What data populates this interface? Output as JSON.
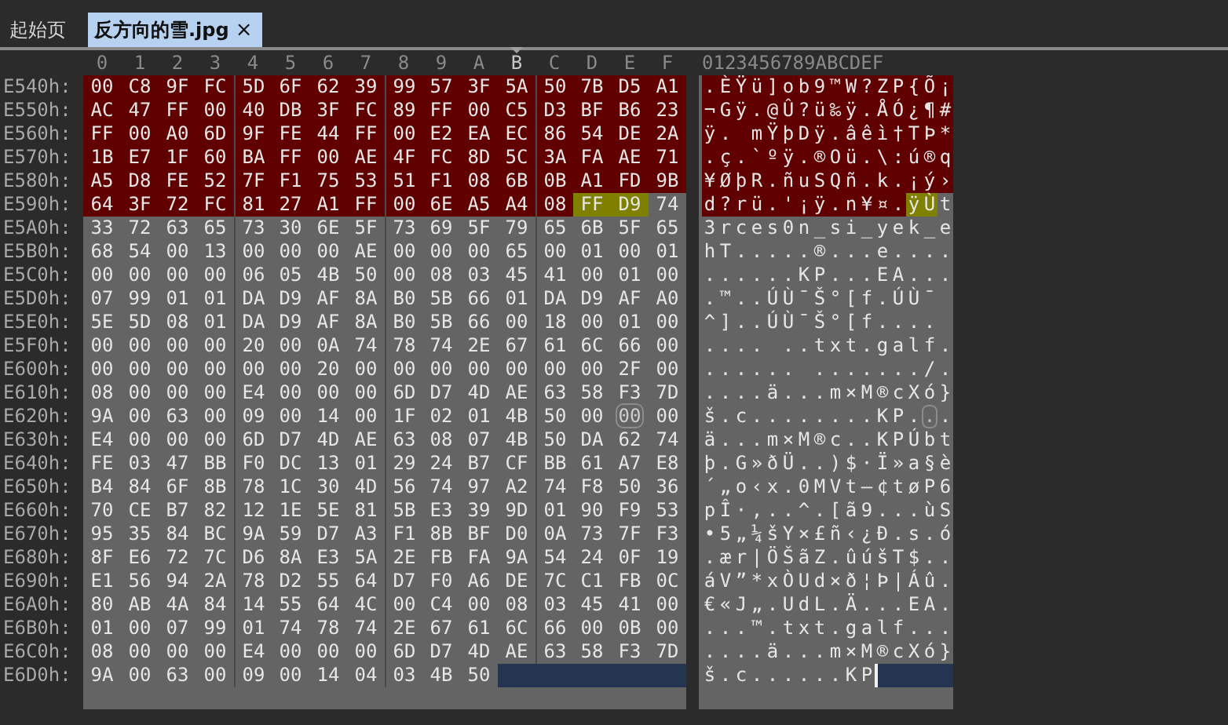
{
  "tabs": [
    {
      "label": "起始页",
      "selected": false
    },
    {
      "label": "反方向的雪.jpg",
      "selected": true,
      "close": "×"
    }
  ],
  "columns": [
    {
      "label": "0",
      "current": false
    },
    {
      "label": "1",
      "current": false
    },
    {
      "label": "2",
      "current": false
    },
    {
      "label": "3",
      "current": false
    },
    {
      "label": "4",
      "current": false
    },
    {
      "label": "5",
      "current": false
    },
    {
      "label": "6",
      "current": false
    },
    {
      "label": "7",
      "current": false
    },
    {
      "label": "8",
      "current": false
    },
    {
      "label": "9",
      "current": false
    },
    {
      "label": "A",
      "current": false
    },
    {
      "label": "B",
      "current": true
    },
    {
      "label": "C",
      "current": false
    },
    {
      "label": "D",
      "current": false
    },
    {
      "label": "E",
      "current": false
    },
    {
      "label": "F",
      "current": false
    }
  ],
  "ascii_header": "0123456789ABCDEF",
  "rows": [
    {
      "offset": "E540h:",
      "segments": [
        {
          "kind": "selected",
          "bytes": [
            "00",
            "C8",
            "9F",
            "FC",
            "5D",
            "6F",
            "62",
            "39",
            "99",
            "57",
            "3F",
            "5A",
            "50",
            "7B",
            "D5",
            "A1"
          ],
          "ascii": ".ÈŸü]ob9™W?ZP{Õ¡"
        }
      ]
    },
    {
      "offset": "E550h:",
      "segments": [
        {
          "kind": "selected",
          "bytes": [
            "AC",
            "47",
            "FF",
            "00",
            "40",
            "DB",
            "3F",
            "FC",
            "89",
            "FF",
            "00",
            "C5",
            "D3",
            "BF",
            "B6",
            "23"
          ],
          "ascii": "¬Gÿ.@Û?ü‰ÿ.ÅÓ¿¶#"
        }
      ]
    },
    {
      "offset": "E560h:",
      "segments": [
        {
          "kind": "selected",
          "bytes": [
            "FF",
            "00",
            "A0",
            "6D",
            "9F",
            "FE",
            "44",
            "FF",
            "00",
            "E2",
            "EA",
            "EC",
            "86",
            "54",
            "DE",
            "2A"
          ],
          "ascii": "ÿ. mŸþDÿ.âêì†TÞ*"
        }
      ]
    },
    {
      "offset": "E570h:",
      "segments": [
        {
          "kind": "selected",
          "bytes": [
            "1B",
            "E7",
            "1F",
            "60",
            "BA",
            "FF",
            "00",
            "AE",
            "4F",
            "FC",
            "8D",
            "5C",
            "3A",
            "FA",
            "AE",
            "71"
          ],
          "ascii": ".ç.`ºÿ.®Oü.\\:ú®q"
        }
      ]
    },
    {
      "offset": "E580h:",
      "segments": [
        {
          "kind": "selected",
          "bytes": [
            "A5",
            "D8",
            "FE",
            "52",
            "7F",
            "F1",
            "75",
            "53",
            "51",
            "F1",
            "08",
            "6B",
            "0B",
            "A1",
            "FD",
            "9B"
          ],
          "ascii": "¥ØþR.ñuSQñ.k.¡ý›"
        }
      ]
    },
    {
      "offset": "E590h:",
      "segments": [
        {
          "kind": "selected",
          "bytes": [
            "64",
            "3F",
            "72",
            "FC",
            "81",
            "27",
            "A1",
            "FF",
            "00",
            "6E",
            "A5",
            "A4",
            "08"
          ],
          "ascii": "d?rü.'¡ÿ.n¥¤."
        },
        {
          "kind": "marked",
          "bytes": [
            "FF",
            "D9"
          ],
          "ascii": "ÿÙ"
        },
        {
          "kind": "plain",
          "bytes": [
            "74"
          ],
          "ascii": "t"
        }
      ]
    },
    {
      "offset": "E5A0h:",
      "segments": [
        {
          "kind": "plain",
          "bytes": [
            "33",
            "72",
            "63",
            "65",
            "73",
            "30",
            "6E",
            "5F",
            "73",
            "69",
            "5F",
            "79",
            "65",
            "6B",
            "5F",
            "65"
          ],
          "ascii": "3rces0n_si_yek_e"
        }
      ]
    },
    {
      "offset": "E5B0h:",
      "segments": [
        {
          "kind": "plain",
          "bytes": [
            "68",
            "54",
            "00",
            "13",
            "00",
            "00",
            "00",
            "AE",
            "00",
            "00",
            "00",
            "65",
            "00",
            "01",
            "00",
            "01"
          ],
          "ascii": "hT.....®...e...."
        }
      ]
    },
    {
      "offset": "E5C0h:",
      "segments": [
        {
          "kind": "plain",
          "bytes": [
            "00",
            "00",
            "00",
            "00",
            "06",
            "05",
            "4B",
            "50",
            "00",
            "08",
            "03",
            "45",
            "41",
            "00",
            "01",
            "00"
          ],
          "ascii": "......KP...EA..."
        }
      ]
    },
    {
      "offset": "E5D0h:",
      "segments": [
        {
          "kind": "plain",
          "bytes": [
            "07",
            "99",
            "01",
            "01",
            "DA",
            "D9",
            "AF",
            "8A",
            "B0",
            "5B",
            "66",
            "01",
            "DA",
            "D9",
            "AF",
            "A0"
          ],
          "ascii": ".™..ÚÙ¯Š°[f.ÚÙ¯ "
        }
      ]
    },
    {
      "offset": "E5E0h:",
      "segments": [
        {
          "kind": "plain",
          "bytes": [
            "5E",
            "5D",
            "08",
            "01",
            "DA",
            "D9",
            "AF",
            "8A",
            "B0",
            "5B",
            "66",
            "00",
            "18",
            "00",
            "01",
            "00"
          ],
          "ascii": "^]..ÚÙ¯Š°[f...."
        }
      ]
    },
    {
      "offset": "E5F0h:",
      "segments": [
        {
          "kind": "plain",
          "bytes": [
            "00",
            "00",
            "00",
            "00",
            "20",
            "00",
            "0A",
            "74",
            "78",
            "74",
            "2E",
            "67",
            "61",
            "6C",
            "66",
            "00"
          ],
          "ascii": ".... ..txt.galf."
        }
      ]
    },
    {
      "offset": "E600h:",
      "segments": [
        {
          "kind": "plain",
          "bytes": [
            "00",
            "00",
            "00",
            "00",
            "00",
            "00",
            "20",
            "00",
            "00",
            "00",
            "00",
            "00",
            "00",
            "00",
            "2F",
            "00"
          ],
          "ascii": "...... ......./."
        }
      ]
    },
    {
      "offset": "E610h:",
      "segments": [
        {
          "kind": "plain",
          "bytes": [
            "08",
            "00",
            "00",
            "00",
            "E4",
            "00",
            "00",
            "00",
            "6D",
            "D7",
            "4D",
            "AE",
            "63",
            "58",
            "F3",
            "7D"
          ],
          "ascii": "....ä...m×M®cXó}"
        }
      ]
    },
    {
      "offset": "E620h:",
      "segments": [
        {
          "kind": "plain",
          "bytes": [
            "9A",
            "00",
            "63",
            "00",
            "09",
            "00",
            "14",
            "00",
            "1F",
            "02",
            "01",
            "4B",
            "50",
            "00"
          ],
          "ascii": "š.c........KP."
        },
        {
          "kind": "bracket",
          "bytes": [
            "00"
          ],
          "ascii": "."
        },
        {
          "kind": "plain",
          "bytes": [
            "00"
          ],
          "ascii": "."
        }
      ]
    },
    {
      "offset": "E630h:",
      "segments": [
        {
          "kind": "plain",
          "bytes": [
            "E4",
            "00",
            "00",
            "00",
            "6D",
            "D7",
            "4D",
            "AE",
            "63",
            "08",
            "07",
            "4B",
            "50",
            "DA",
            "62",
            "74"
          ],
          "ascii": "ä...m×M®c..KPÚbt"
        }
      ]
    },
    {
      "offset": "E640h:",
      "segments": [
        {
          "kind": "plain",
          "bytes": [
            "FE",
            "03",
            "47",
            "BB",
            "F0",
            "DC",
            "13",
            "01",
            "29",
            "24",
            "B7",
            "CF",
            "BB",
            "61",
            "A7",
            "E8"
          ],
          "ascii": "þ.G»ðÜ..)$·Ï»a§è"
        }
      ]
    },
    {
      "offset": "E650h:",
      "segments": [
        {
          "kind": "plain",
          "bytes": [
            "B4",
            "84",
            "6F",
            "8B",
            "78",
            "1C",
            "30",
            "4D",
            "56",
            "74",
            "97",
            "A2",
            "74",
            "F8",
            "50",
            "36"
          ],
          "ascii": "´„o‹x.0MVt—¢tøP6"
        }
      ]
    },
    {
      "offset": "E660h:",
      "segments": [
        {
          "kind": "plain",
          "bytes": [
            "70",
            "CE",
            "B7",
            "82",
            "12",
            "1E",
            "5E",
            "81",
            "5B",
            "E3",
            "39",
            "9D",
            "01",
            "90",
            "F9",
            "53"
          ],
          "ascii": "pÎ·‚..^.[ã9...ùS"
        }
      ]
    },
    {
      "offset": "E670h:",
      "segments": [
        {
          "kind": "plain",
          "bytes": [
            "95",
            "35",
            "84",
            "BC",
            "9A",
            "59",
            "D7",
            "A3",
            "F1",
            "8B",
            "BF",
            "D0",
            "0A",
            "73",
            "7F",
            "F3"
          ],
          "ascii": "•5„¼šY×£ñ‹¿Ð.s.ó"
        }
      ]
    },
    {
      "offset": "E680h:",
      "segments": [
        {
          "kind": "plain",
          "bytes": [
            "8F",
            "E6",
            "72",
            "7C",
            "D6",
            "8A",
            "E3",
            "5A",
            "2E",
            "FB",
            "FA",
            "9A",
            "54",
            "24",
            "0F",
            "19"
          ],
          "ascii": ".ær|ÖŠãZ.ûúšT$.."
        }
      ]
    },
    {
      "offset": "E690h:",
      "segments": [
        {
          "kind": "plain",
          "bytes": [
            "E1",
            "56",
            "94",
            "2A",
            "78",
            "D2",
            "55",
            "64",
            "D7",
            "F0",
            "A6",
            "DE",
            "7C",
            "C1",
            "FB",
            "0C"
          ],
          "ascii": "áV”*xÒUd×ð¦Þ|Áû."
        }
      ]
    },
    {
      "offset": "E6A0h:",
      "segments": [
        {
          "kind": "plain",
          "bytes": [
            "80",
            "AB",
            "4A",
            "84",
            "14",
            "55",
            "64",
            "4C",
            "00",
            "C4",
            "00",
            "08",
            "03",
            "45",
            "41",
            "00"
          ],
          "ascii": "€«J„.UdL.Ä...EA."
        }
      ]
    },
    {
      "offset": "E6B0h:",
      "segments": [
        {
          "kind": "plain",
          "bytes": [
            "01",
            "00",
            "07",
            "99",
            "01",
            "74",
            "78",
            "74",
            "2E",
            "67",
            "61",
            "6C",
            "66",
            "00",
            "0B",
            "00"
          ],
          "ascii": "...™.txt.galf..."
        }
      ]
    },
    {
      "offset": "E6C0h:",
      "segments": [
        {
          "kind": "plain",
          "bytes": [
            "08",
            "00",
            "00",
            "00",
            "E4",
            "00",
            "00",
            "00",
            "6D",
            "D7",
            "4D",
            "AE",
            "63",
            "58",
            "F3",
            "7D"
          ],
          "ascii": "....ä...m×M®cXó}"
        }
      ]
    },
    {
      "offset": "E6D0h:",
      "segments": [
        {
          "kind": "plain",
          "bytes": [
            "9A",
            "00",
            "63",
            "00",
            "09",
            "00",
            "14",
            "04",
            "03",
            "4B",
            "50"
          ],
          "ascii": "š.c......KP"
        }
      ]
    }
  ]
}
